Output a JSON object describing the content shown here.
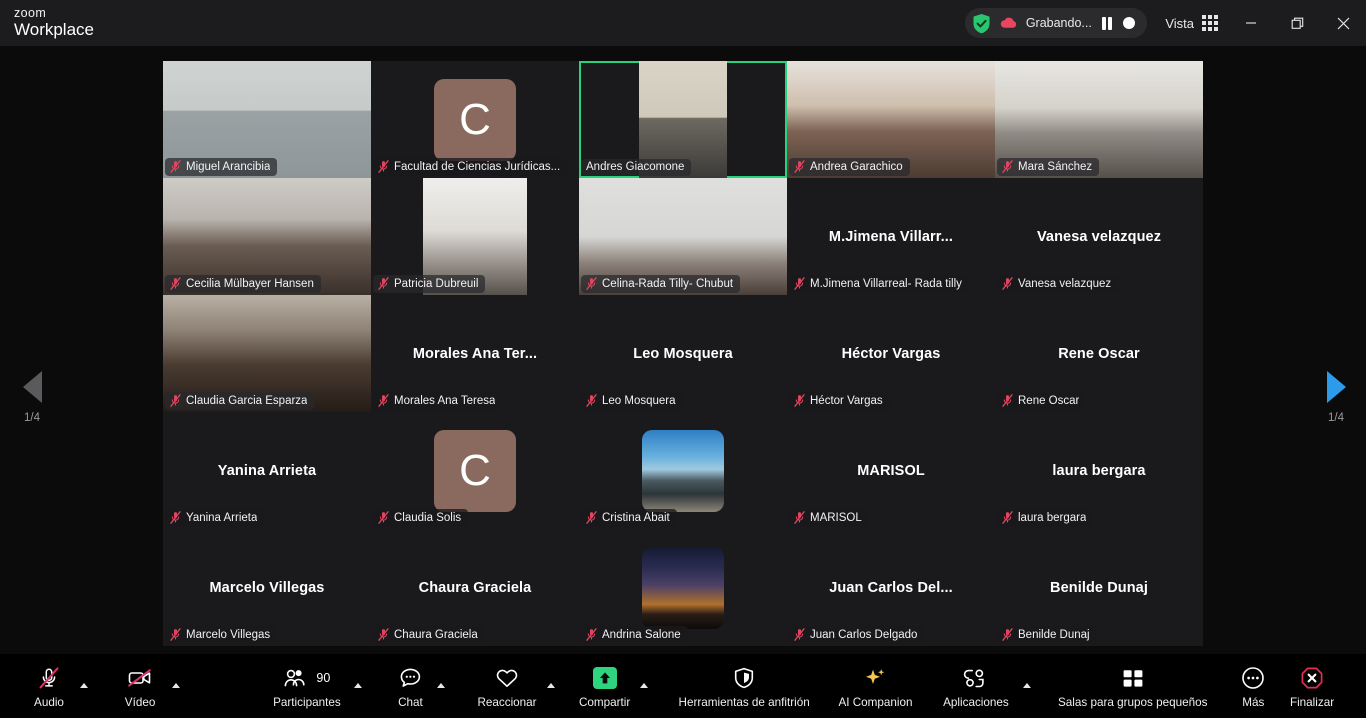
{
  "titlebar": {
    "brand_line1": "zoom",
    "brand_line2": "Workplace",
    "recording_label": "Grabando...",
    "view_label": "Vista",
    "minimize_title": "Minimizar",
    "restore_title": "Restaurar",
    "close_title": "Cerrar"
  },
  "pager": {
    "left_label": "1/4",
    "right_label": "1/4"
  },
  "gallery": {
    "tiles": [
      {
        "name": "Miguel Arancibia",
        "display": "Miguel Arancibia",
        "video": true,
        "muted": true,
        "active": false,
        "kind": "video",
        "fill": "full",
        "bg": "miguel"
      },
      {
        "name": "Facultad de Ciencias Jurídicas...",
        "display": "Facultad de Ciencias Jurídicas...",
        "video": false,
        "muted": true,
        "active": false,
        "kind": "avatar-letter",
        "letter": "C",
        "avatar_color": "#8a6a5e"
      },
      {
        "name": "Andres Giacomone",
        "display": "Andres Giacomone",
        "video": true,
        "muted": false,
        "active": true,
        "kind": "video",
        "fill": "narrow",
        "bg": "andres"
      },
      {
        "name": "Andrea Garachico",
        "display": "Andrea Garachico",
        "video": true,
        "muted": true,
        "active": false,
        "kind": "video",
        "fill": "full",
        "bg": "andrea"
      },
      {
        "name": "Mara Sánchez",
        "display": "Mara Sánchez",
        "video": true,
        "muted": true,
        "active": false,
        "kind": "video",
        "fill": "full",
        "bg": "mara"
      },
      {
        "name": "Cecilia Mülbayer Hansen",
        "display": "Cecilia Mülbayer Hansen",
        "video": true,
        "muted": true,
        "active": false,
        "kind": "video",
        "fill": "full",
        "bg": "cecilia"
      },
      {
        "name": "Patricia Dubreuil",
        "display": "Patricia Dubreuil",
        "video": true,
        "muted": true,
        "active": false,
        "kind": "video",
        "fill": "narrow2",
        "bg": "patricia"
      },
      {
        "name": "Celina-Rada Tilly- Chubut",
        "display": "Celina-Rada Tilly- Chubut",
        "video": true,
        "muted": true,
        "active": false,
        "kind": "video",
        "fill": "full",
        "bg": "celina"
      },
      {
        "name": "M.Jimena Villarreal- Rada tilly",
        "display": "M.Jimena  Villarr...",
        "video": false,
        "muted": true,
        "active": false,
        "kind": "name-only"
      },
      {
        "name": "Vanesa velazquez",
        "display": "Vanesa velazquez",
        "video": false,
        "muted": true,
        "active": false,
        "kind": "name-only"
      },
      {
        "name": "Claudia  Garcia Esparza",
        "display": "Claudia  Garcia Esparza",
        "video": true,
        "muted": true,
        "active": false,
        "kind": "video",
        "fill": "full",
        "bg": "claudia"
      },
      {
        "name": "Morales Ana Teresa",
        "display": "Morales Ana Ter...",
        "video": false,
        "muted": true,
        "active": false,
        "kind": "name-only"
      },
      {
        "name": "Leo Mosquera",
        "display": "Leo Mosquera",
        "video": false,
        "muted": true,
        "active": false,
        "kind": "name-only"
      },
      {
        "name": "Héctor Vargas",
        "display": "Héctor Vargas",
        "video": false,
        "muted": true,
        "active": false,
        "kind": "name-only"
      },
      {
        "name": "Rene Oscar",
        "display": "Rene Oscar",
        "video": false,
        "muted": true,
        "active": false,
        "kind": "name-only"
      },
      {
        "name": "Yanina Arrieta",
        "display": "Yanina Arrieta",
        "video": false,
        "muted": true,
        "active": false,
        "kind": "name-only"
      },
      {
        "name": "Claudia Solis",
        "display": "Claudia Solis",
        "video": false,
        "muted": true,
        "active": false,
        "kind": "avatar-letter",
        "letter": "C",
        "avatar_color": "#8a6a5e"
      },
      {
        "name": "Cristina Abait",
        "display": "Cristina Abait",
        "video": false,
        "muted": true,
        "active": false,
        "kind": "avatar-photo",
        "photo": "seaside"
      },
      {
        "name": "MARISOL",
        "display": "MARISOL",
        "video": false,
        "muted": true,
        "active": false,
        "kind": "name-only"
      },
      {
        "name": "laura bergara",
        "display": "laura bergara",
        "video": false,
        "muted": true,
        "active": false,
        "kind": "name-only"
      },
      {
        "name": "Marcelo Villegas",
        "display": "Marcelo Villegas",
        "video": false,
        "muted": true,
        "active": false,
        "kind": "name-only"
      },
      {
        "name": "Chaura Graciela",
        "display": "Chaura Graciela",
        "video": false,
        "muted": true,
        "active": false,
        "kind": "name-only"
      },
      {
        "name": "Andrina Salone",
        "display": "Andrina Salone",
        "video": false,
        "muted": true,
        "active": false,
        "kind": "avatar-photo",
        "photo": "dusk"
      },
      {
        "name": "Juan Carlos Delgado",
        "display": "Juan  Carlos  Del...",
        "video": false,
        "muted": true,
        "active": false,
        "kind": "name-only"
      },
      {
        "name": "Benilde Dunaj",
        "display": "Benilde Dunaj",
        "video": false,
        "muted": true,
        "active": false,
        "kind": "name-only"
      }
    ]
  },
  "toolbar": {
    "audio_label": "Audio",
    "video_label": "Vídeo",
    "participants_label": "Participantes",
    "participants_count": "90",
    "chat_label": "Chat",
    "react_label": "Reaccionar",
    "share_label": "Compartir",
    "hosttools_label": "Herramientas de anfitrión",
    "ai_label": "AI Companion",
    "apps_label": "Aplicaciones",
    "breakout_label": "Salas para grupos pequeños",
    "more_label": "Más",
    "end_label": "Finalizar"
  },
  "colors": {
    "accent_green": "#2fd47e",
    "active_speaker": "#28d17c",
    "mute_red": "#d9415a",
    "end_red": "#e02d54",
    "pager_active": "#2b9bea",
    "ai_gold": "#f5c451"
  }
}
